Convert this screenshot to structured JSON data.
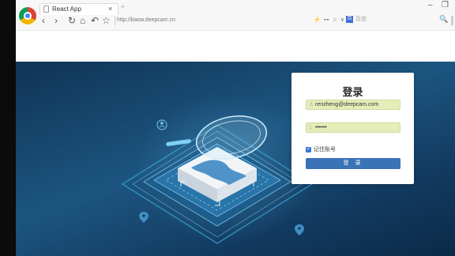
{
  "browser": {
    "tab_title": "React App",
    "tab_close": "×",
    "new_tab": "+",
    "url": "http://baow.deepcam.cn",
    "address_tools": "⚡ ⊶ ☆ ∨",
    "search_engine_glyph": "百",
    "search_placeholder": "百度",
    "window_minimize": "–",
    "window_restore": "❐",
    "nav": {
      "back": "‹",
      "forward": "›",
      "refresh": "↻",
      "home": "⌂",
      "undo": "↶",
      "bookmark": "☆"
    },
    "search_button": "🔍"
  },
  "login": {
    "title": "登录",
    "email_value": "renzheng@deepcam.com",
    "password_value": "••••••",
    "remember_label": "记住账号",
    "remember_checked": true,
    "submit_label": "登 录"
  },
  "colors": {
    "accent": "#3a73b6",
    "autofill": "#e6edb9",
    "stage_dark": "#0f3456",
    "stage_mid": "#1c5580",
    "chip_blue": "#4f93c9"
  },
  "icons": [
    "browser-logo-icon",
    "page-icon",
    "close-icon",
    "back-icon",
    "forward-icon",
    "refresh-icon",
    "home-icon",
    "undo-icon",
    "star-icon",
    "search-icon",
    "user-icon",
    "lock-icon",
    "checkbox-icon",
    "person-pin-icon",
    "location-pin-icon"
  ]
}
